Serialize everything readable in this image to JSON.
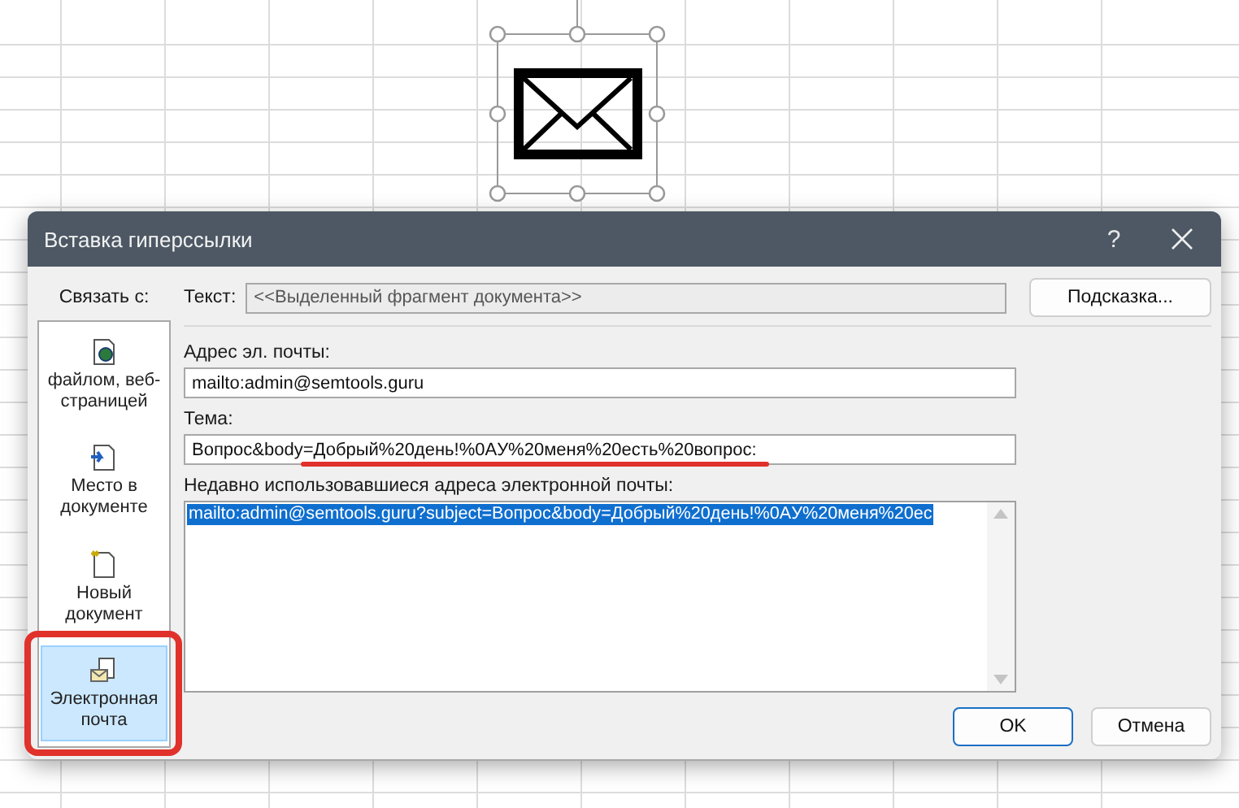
{
  "dialog": {
    "title": "Вставка гиперссылки",
    "help": "?"
  },
  "link_to": {
    "label": "Связать с:",
    "items": [
      {
        "kind": "file",
        "label": "файлом, веб-страницей",
        "selected": false
      },
      {
        "kind": "place",
        "label": "Место в документе",
        "selected": false
      },
      {
        "kind": "new",
        "label": "Новый документ",
        "selected": false
      },
      {
        "kind": "email",
        "label": "Электронная почта",
        "selected": true
      }
    ]
  },
  "text_field": {
    "label": "Текст:",
    "value": "<<Выделенный фрагмент документа>>",
    "disabled": true
  },
  "tip_button": "Подсказка...",
  "email_field": {
    "label": "Адрес эл. почты:",
    "value": "mailto:admin@semtools.guru"
  },
  "subject_field": {
    "label": "Тема:",
    "value": "Вопрос&body=Добрый%20день!%0AУ%20меня%20есть%20вопрос:"
  },
  "recent": {
    "label": "Недавно использовавшиеся адреса электронной почты:",
    "items": [
      {
        "text": "mailto:admin@semtools.guru?subject=Вопрос&body=Добрый%20день!%0AУ%20меня%20ес",
        "selected": true
      }
    ]
  },
  "buttons": [
    {
      "label": "OK",
      "default": true
    },
    {
      "label": "Отмена",
      "default": false
    }
  ]
}
